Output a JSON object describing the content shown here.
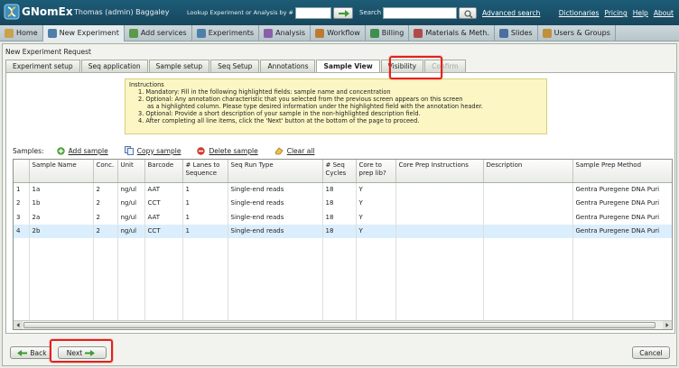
{
  "header": {
    "brand": "GNomEx",
    "user": "Thomas (admin) Baggaley",
    "lookup_label": "Lookup Experiment or Analysis by #",
    "search_label": "Search",
    "advanced_search": "Advanced search",
    "links": [
      "Dictionaries",
      "Pricing",
      "Help",
      "About"
    ]
  },
  "nav": {
    "items": [
      {
        "label": "Home",
        "icon": "home-icon",
        "color": "#c9a24a"
      },
      {
        "label": "New Experiment",
        "icon": "flask-icon",
        "color": "#4f7fa8"
      },
      {
        "label": "Add services",
        "icon": "services-icon",
        "color": "#5a9a4a"
      },
      {
        "label": "Experiments",
        "icon": "experiments-icon",
        "color": "#4f7fa8"
      },
      {
        "label": "Analysis",
        "icon": "analysis-icon",
        "color": "#8a5fa8"
      },
      {
        "label": "Workflow",
        "icon": "workflow-icon",
        "color": "#c07a30"
      },
      {
        "label": "Billing",
        "icon": "billing-icon",
        "color": "#3f8f4f"
      },
      {
        "label": "Materials & Meth.",
        "icon": "materials-icon",
        "color": "#b04a4a"
      },
      {
        "label": "Slides",
        "icon": "slides-icon",
        "color": "#4a6fa0"
      },
      {
        "label": "Users & Groups",
        "icon": "users-icon",
        "color": "#c0903a"
      }
    ],
    "active_index": 1
  },
  "panel": {
    "title": "New Experiment Request",
    "tabs": [
      {
        "label": "Experiment setup",
        "state": "normal"
      },
      {
        "label": "Seq application",
        "state": "normal"
      },
      {
        "label": "Sample setup",
        "state": "normal"
      },
      {
        "label": "Seq Setup",
        "state": "normal"
      },
      {
        "label": "Annotations",
        "state": "normal"
      },
      {
        "label": "Sample View",
        "state": "active"
      },
      {
        "label": "Visibility",
        "state": "normal"
      },
      {
        "label": "Confirm",
        "state": "disabled"
      }
    ]
  },
  "instructions": {
    "title": "Instructions",
    "lines": [
      "1.  Mandatory: Fill in the following highlighted fields:  sample name and concentration",
      "2.  Optional: Any annotation characteristic that you selected from the previous screen appears on this screen",
      "as a highlighted column. Please type desired information under the highlighted field with the annotation header.",
      "3.  Optional: Provide a short description of your sample in the non-highlighted description field.",
      "4.  After completing all line items, click the 'Next' button at the bottom of the page to proceed."
    ]
  },
  "toolbar": {
    "label": "Samples:",
    "add_sample": "Add sample",
    "copy_sample": "Copy sample",
    "delete_sample": "Delete sample",
    "clear_all": "Clear all"
  },
  "grid": {
    "columns": [
      "",
      "Sample Name",
      "Conc.",
      "Unit",
      "Barcode",
      "# Lanes to Sequence",
      "Seq Run Type",
      "# Seq Cycles",
      "Core to prep lib?",
      "Core Prep Instructions",
      "Description",
      "Sample Prep Method"
    ],
    "rows": [
      [
        "1",
        "1a",
        "2",
        "ng/ul",
        "AAT",
        "1",
        "Single-end reads",
        "18",
        "Y",
        "",
        "",
        "Gentra Puregene DNA Puri"
      ],
      [
        "2",
        "1b",
        "2",
        "ng/ul",
        "CCT",
        "1",
        "Single-end reads",
        "18",
        "Y",
        "",
        "",
        "Gentra Puregene DNA Puri"
      ],
      [
        "3",
        "2a",
        "2",
        "ng/ul",
        "AAT",
        "1",
        "Single-end reads",
        "18",
        "Y",
        "",
        "",
        "Gentra Puregene DNA Puri"
      ],
      [
        "4",
        "2b",
        "2",
        "ng/ul",
        "CCT",
        "1",
        "Single-end reads",
        "18",
        "Y",
        "",
        "",
        "Gentra Puregene DNA Puri"
      ]
    ],
    "selected_row": 3,
    "empty_rows": 6
  },
  "buttons": {
    "back": "Back",
    "next": "Next",
    "cancel": "Cancel"
  },
  "colors": {
    "header_bg": "#1d5c77",
    "instructions_bg": "#fbf6c4",
    "selected_row": "#dbeefd",
    "highlight_box": "#e3211e"
  }
}
